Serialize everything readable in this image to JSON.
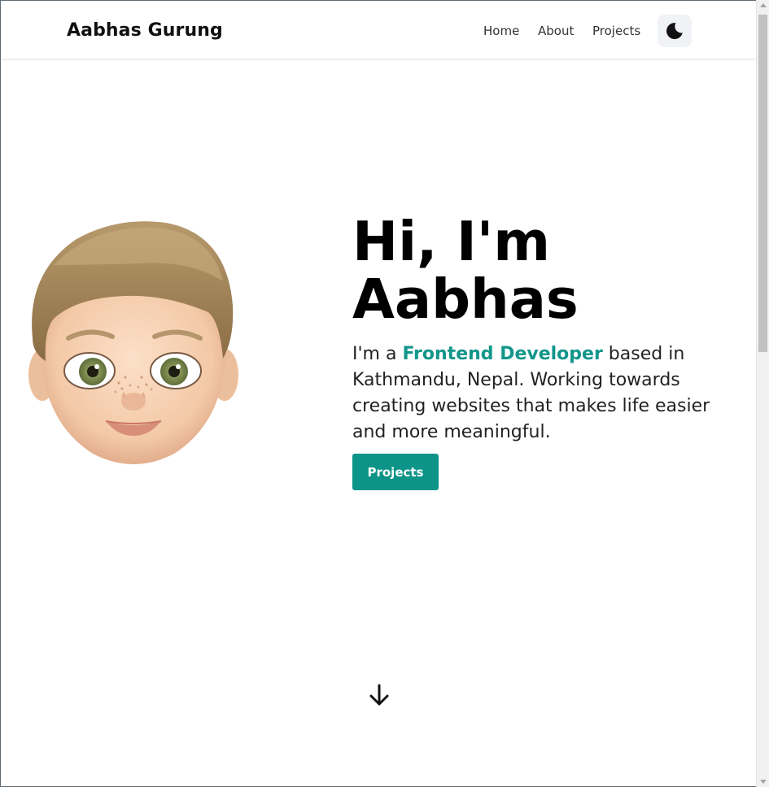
{
  "nav": {
    "brand": "Aabhas Gurung",
    "links": [
      "Home",
      "About",
      "Projects"
    ],
    "theme_icon": "moon-icon"
  },
  "hero": {
    "title_line1": "Hi, I'm",
    "title_line2": "Aabhas",
    "desc_prefix": "I'm a ",
    "desc_highlight": "Frontend Developer",
    "desc_suffix": " based in Kathmandu, Nepal. Working towards creating websites that makes life easier and more meaningful.",
    "cta_label": "Projects",
    "avatar_icon": "memoji-avatar",
    "scroll_icon": "arrow-down-icon"
  },
  "colors": {
    "accent": "#0d9488",
    "text": "#111111",
    "background": "#ffffff"
  }
}
